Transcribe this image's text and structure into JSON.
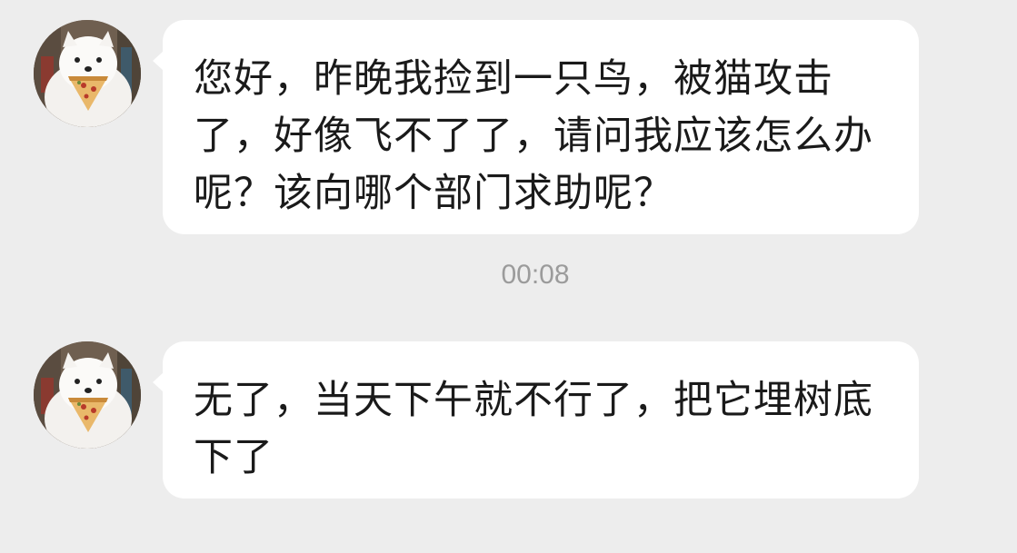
{
  "messages": [
    {
      "sender": "other",
      "avatar_icon": "samoyed-with-pizza-avatar",
      "text": "您好，昨晚我捡到一只鸟，被猫攻击了，好像飞不了了，请问我应该怎么办呢？该向哪个部门求助呢？"
    },
    {
      "sender": "other",
      "avatar_icon": "samoyed-with-pizza-avatar",
      "text": "无了，当天下午就不行了，把它埋树底下了"
    }
  ],
  "timestamp": "00:08",
  "colors": {
    "background": "#ededed",
    "bubble": "#ffffff",
    "text": "#1a1a1a",
    "timestamp": "#9b9b9b"
  }
}
